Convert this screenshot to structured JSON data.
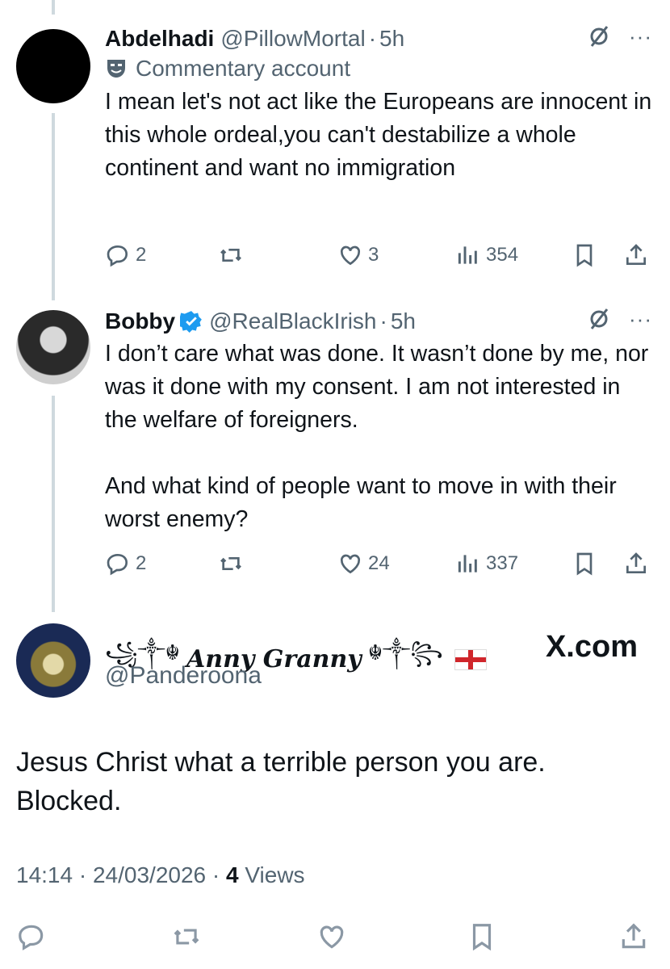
{
  "tweets": [
    {
      "name": "Abdelhadi",
      "handle": "@PillowMortal",
      "separator": "·",
      "time": "5h",
      "commentary_label": "Commentary account",
      "text": "I mean let's not act like the Europeans are innocent in this whole ordeal,you can't destabilize a whole continent and want no immigration",
      "replies": "2",
      "likes": "3",
      "views": "354"
    },
    {
      "name": "Bobby",
      "handle": "@RealBlackIrish",
      "separator": "·",
      "time": "5h",
      "text_p1": "I don’t care what was done. It wasn’t done by me, nor was it done with my consent. I am not interested in the welfare of foreigners.",
      "text_p2": "And what kind of people want to move in with their worst enemy?",
      "replies": "2",
      "likes": "24",
      "views": "337"
    }
  ],
  "main_tweet": {
    "ornament_left": "꧁༒☬",
    "name": "Anny Granny",
    "ornament_right": "☬༒꧂",
    "handle": "@Panderoona",
    "watermark": "X.com",
    "text_line1": "Jesus Christ what a terrible person you are.",
    "text_line2": "Blocked.",
    "time": "14:14",
    "separator": "·",
    "date": "24/03/2026",
    "views_count": "4",
    "views_label": "Views"
  },
  "colors": {
    "text": "#0f1419",
    "secondary": "#536471",
    "verified": "#1d9bf0",
    "thread_line": "#cfd9de"
  }
}
